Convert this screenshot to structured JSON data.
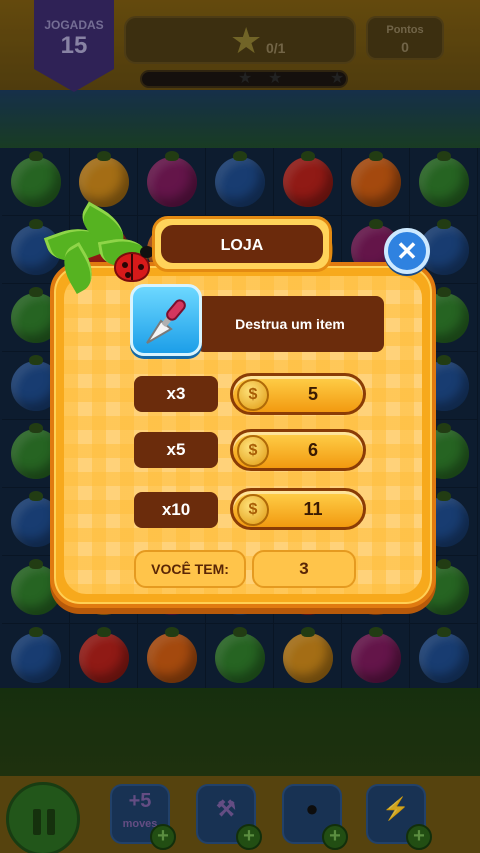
{
  "hud": {
    "moves_label": "JOGADAS",
    "moves_value": "15",
    "goal_progress": "0/1",
    "score_label": "Pontos",
    "score_value": "0"
  },
  "booster_bar": {
    "extra_moves_label": "+5",
    "extra_moves_sub": "moves"
  },
  "shop": {
    "title": "LOJA",
    "close_symbol": "✕",
    "item_description": "Destrua um item",
    "item_icon": "trowel-icon",
    "offers": [
      {
        "quantity": "x3",
        "price": "5"
      },
      {
        "quantity": "x5",
        "price": "6"
      },
      {
        "quantity": "x10",
        "price": "11"
      }
    ],
    "coin_symbol": "$",
    "balance_label": "VOCÊ TEM:",
    "balance_value": "3"
  },
  "colors": {
    "modal_orange": "#f7a91c",
    "plate_brown": "#6b2c0c",
    "close_blue": "#2f82e0",
    "buy_gold": "#ffd04a"
  }
}
